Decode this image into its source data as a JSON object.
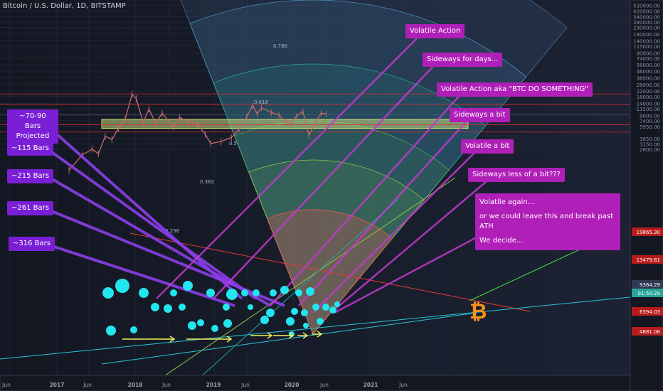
{
  "header": {
    "symbol": "Bitcoin / U.S. Dollar, 1D, BITSTAMP"
  },
  "colors": {
    "purple_note": "#7b1fd6",
    "magenta_note": "#b01fb8",
    "fib_0236": "#ef5350",
    "fib_0382": "#8bc34a",
    "fib_05": "#4caf50",
    "fib_0618": "#26a69a",
    "fib_0786": "#4a90b8",
    "cyan_dots": "#22e5ee",
    "range_box": "#c8d87a",
    "bitcoin_orange": "#f7931a"
  },
  "fib_labels": [
    "0.236",
    "0.382",
    "0.5",
    "0.618",
    "0.786"
  ],
  "left_notes": [
    {
      "text": "~70-90 Bars\nProjected"
    },
    {
      "text": "~115 Bars"
    },
    {
      "text": "~215 Bars"
    },
    {
      "text": "~261 Bars"
    },
    {
      "text": "~316 Bars"
    }
  ],
  "right_notes": [
    {
      "text": "Volatile Action"
    },
    {
      "text": "Sideways for days..."
    },
    {
      "text": "Volatile Action aka \"BTC DO SOMETHING\""
    },
    {
      "text": "Sideways a bit"
    },
    {
      "text": "Volatile a bit"
    },
    {
      "text": "Sideways less of a bit???"
    }
  ],
  "final_note": {
    "line1": "Volatile again...",
    "line2": "or we could leave this and break past ATH",
    "line3": "We decide..."
  },
  "bitcoin_glyph": "₿",
  "price_tags": [
    {
      "text": "19865.30",
      "bg": "#b71c1c",
      "fg": "#ffffff"
    },
    {
      "text": "13479.61",
      "bg": "#b71c1c",
      "fg": "#ffffff"
    },
    {
      "text": "9364.29",
      "bg": "#2f3a52",
      "fg": "#ffffff"
    },
    {
      "text": "01:50:29",
      "bg": "#26a69a",
      "fg": "#ffffff"
    },
    {
      "text": "6394.03",
      "bg": "#b71c1c",
      "fg": "#ffffff"
    },
    {
      "text": "4881.06",
      "bg": "#b71c1c",
      "fg": "#ffffff"
    }
  ],
  "chart_data": {
    "type": "line",
    "title": "Bitcoin / U.S. Dollar, 1D, BITSTAMP",
    "y_scale": "log",
    "y_ticks": [
      "520000.00",
      "420000.00",
      "340000.00",
      "280000.00",
      "230000.00",
      "180000.00",
      "140000.00",
      "115000.00",
      "90000.00",
      "74000.00",
      "58000.00",
      "46000.00",
      "36000.00",
      "28000.00",
      "22000.00",
      "18000.00",
      "14000.00",
      "11500.00",
      "9000.00",
      "7400.00",
      "5950.00",
      "3850.00",
      "3150.00",
      "2600.00"
    ],
    "x_ticks": [
      "Jun",
      "2017",
      "Jun",
      "2018",
      "Jun",
      "2019",
      "Jun",
      "2020",
      "Jun",
      "2021",
      "Jun"
    ],
    "ylim": [
      2400,
      560000
    ],
    "xlim": [
      "2016-05-01",
      "2021-11-01"
    ],
    "price_series": [
      [
        "2017-03-01",
        1200
      ],
      [
        "2017-05-01",
        2100
      ],
      [
        "2017-06-15",
        2600
      ],
      [
        "2017-07-15",
        2200
      ],
      [
        "2017-08-15",
        4200
      ],
      [
        "2017-09-15",
        3700
      ],
      [
        "2017-10-15",
        5600
      ],
      [
        "2017-11-15",
        7800
      ],
      [
        "2017-12-17",
        19665
      ],
      [
        "2018-01-05",
        16800
      ],
      [
        "2018-02-06",
        7000
      ],
      [
        "2018-03-05",
        11400
      ],
      [
        "2018-04-05",
        6700
      ],
      [
        "2018-05-05",
        9800
      ],
      [
        "2018-06-25",
        5900
      ],
      [
        "2018-07-25",
        8400
      ],
      [
        "2018-09-01",
        7100
      ],
      [
        "2018-10-15",
        6500
      ],
      [
        "2018-11-20",
        4500
      ],
      [
        "2018-12-15",
        3200
      ],
      [
        "2019-02-01",
        3450
      ],
      [
        "2019-03-20",
        4000
      ],
      [
        "2019-04-25",
        5400
      ],
      [
        "2019-05-30",
        8600
      ],
      [
        "2019-06-26",
        13000
      ],
      [
        "2019-07-17",
        9500
      ],
      [
        "2019-08-06",
        12000
      ],
      [
        "2019-09-20",
        10000
      ],
      [
        "2019-10-25",
        9200
      ],
      [
        "2019-11-25",
        7100
      ],
      [
        "2019-12-18",
        6600
      ],
      [
        "2020-01-15",
        8800
      ],
      [
        "2020-02-13",
        10400
      ],
      [
        "2020-03-12",
        4300
      ],
      [
        "2020-04-10",
        6900
      ],
      [
        "2020-05-07",
        9800
      ],
      [
        "2020-05-30",
        9500
      ]
    ],
    "fib_levels": [
      0.236,
      0.382,
      0.5,
      0.618,
      0.786
    ],
    "range_box_prices": [
      5600,
      7800
    ],
    "horizontal_levels": [
      19865.3,
      13479.61,
      9364.29,
      6394.03,
      4881.06
    ],
    "annotations": [
      "~70-90 Bars Projected",
      "~115 Bars",
      "~215 Bars",
      "~261 Bars",
      "~316 Bars",
      "Volatile Action",
      "Sideways for days...",
      "Volatile Action aka \"BTC DO SOMETHING\"",
      "Sideways a bit",
      "Volatile a bit",
      "Sideways less of a bit???",
      "Volatile again...",
      "or we could leave this and break past ATH",
      "We decide..."
    ]
  }
}
